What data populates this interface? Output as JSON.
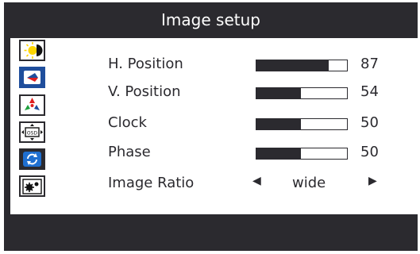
{
  "title": "Image setup",
  "sidebar": {
    "icons": [
      {
        "name": "brightness-contrast-icon",
        "selected": false
      },
      {
        "name": "image-setup-icon",
        "selected": true
      },
      {
        "name": "color-icon",
        "selected": false
      },
      {
        "name": "osd-settings-icon",
        "selected": false
      },
      {
        "name": "reset-icon",
        "selected": false
      },
      {
        "name": "setup-icon",
        "selected": false
      }
    ]
  },
  "items": [
    {
      "label": "H. Position",
      "value": "87",
      "level": 0.8
    },
    {
      "label": "V. Position",
      "value": "54",
      "level": 0.49
    },
    {
      "label": "Clock",
      "value": "50",
      "level": 0.49
    },
    {
      "label": "Phase",
      "value": "50",
      "level": 0.49
    }
  ],
  "image_ratio": {
    "label": "Image Ratio",
    "left_arrow": "◀",
    "value": "wide",
    "right_arrow": "▶"
  },
  "colors": {
    "osd_background": "#2b2a2f",
    "selected_icon": "#1f4e9c",
    "panel": "#ffffff"
  }
}
